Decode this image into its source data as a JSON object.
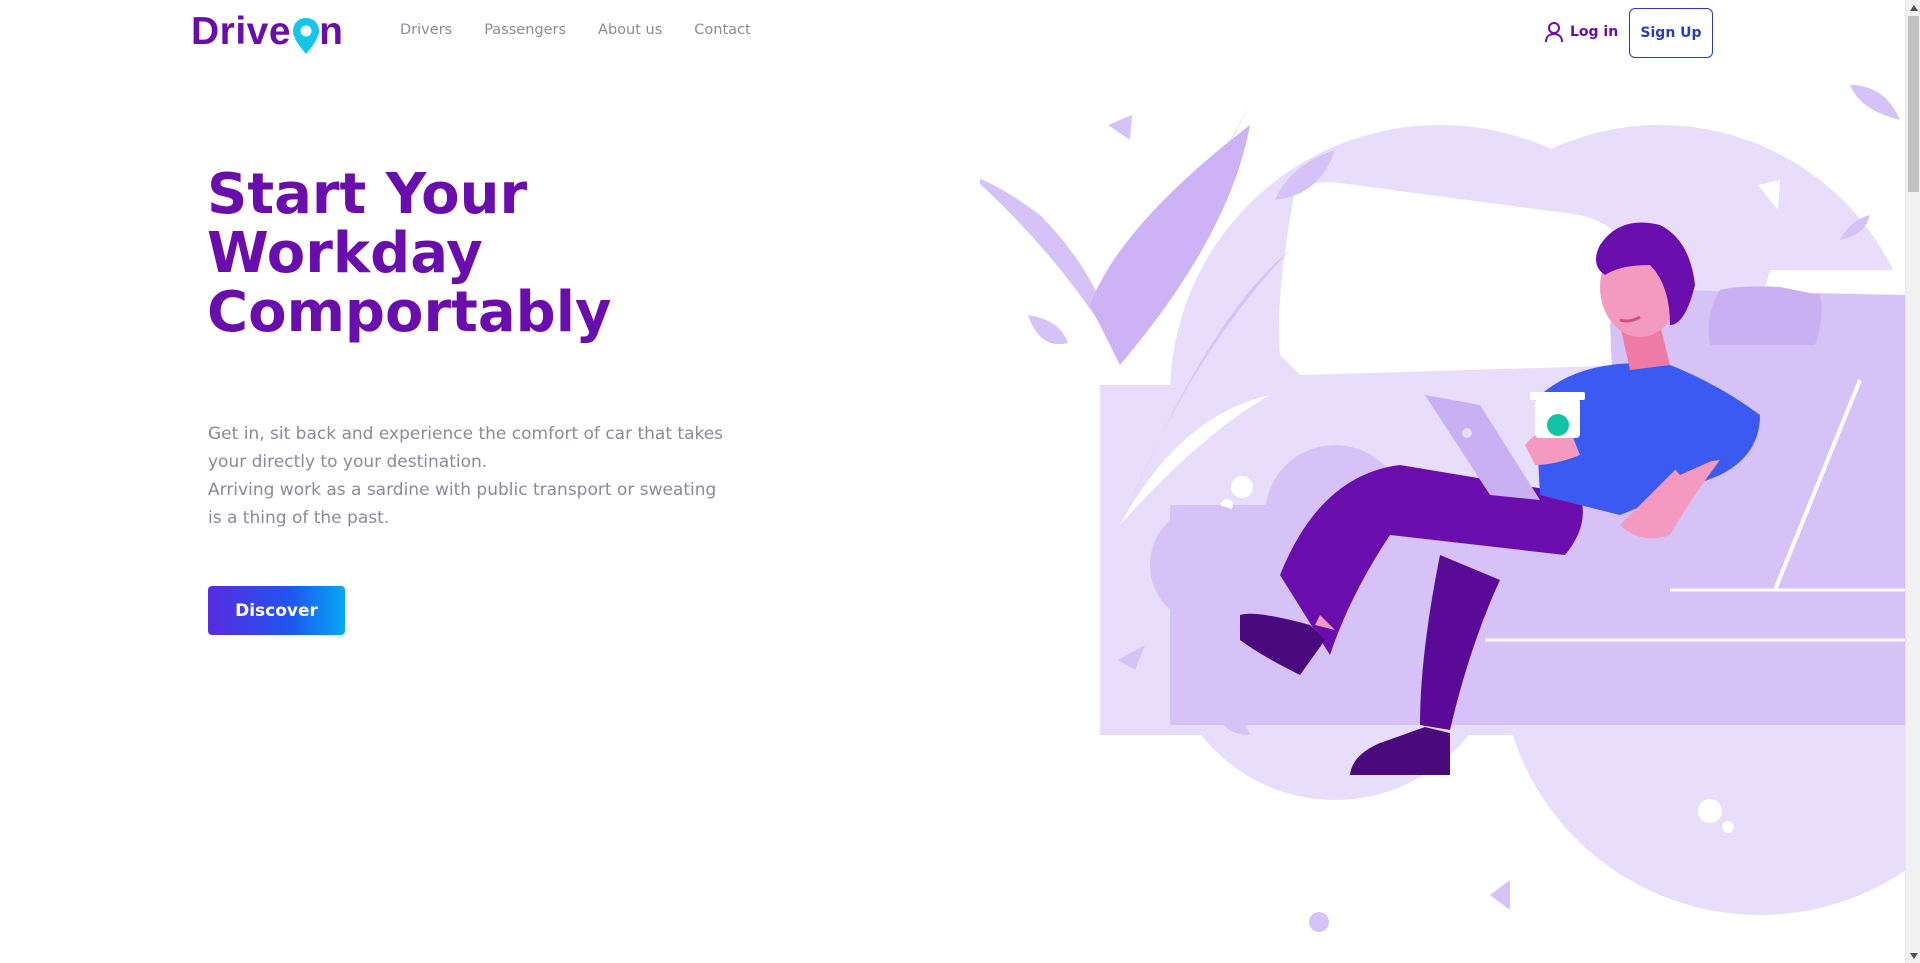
{
  "brand": {
    "logo_left": "Drive",
    "logo_right": "n",
    "primary_color": "#6a0dad",
    "accent_color": "#2a3db8",
    "pin_color": "#15c6e8"
  },
  "nav": {
    "items": [
      {
        "label": "Drivers"
      },
      {
        "label": "Passengers"
      },
      {
        "label": "About us"
      },
      {
        "label": "Contact"
      }
    ]
  },
  "auth": {
    "login_label": "Log in",
    "signup_label": "Sign Up",
    "user_icon": "user-icon"
  },
  "hero": {
    "title_line1": "Start Your",
    "title_line2": "Workday",
    "title_line3": "Comportably",
    "desc_p1": "Get in, sit back and experience the comfort of car that takes your directly to your destination.",
    "desc_p2": "Arriving work as a sardine with public transport or sweating is a thing of the past.",
    "cta_label": "Discover"
  },
  "illustration": {
    "subject": "man-with-coffee-and-tablet-in-car-illustration"
  }
}
